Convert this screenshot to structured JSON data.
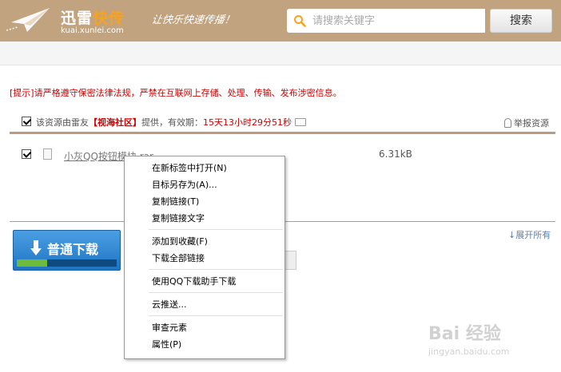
{
  "header": {
    "brand_main": "迅雷",
    "brand_accent": "快传",
    "brand_domain": "kuai.xunlei.com",
    "slogan": "让快乐快速传播！",
    "search_placeholder": "请搜索关键字",
    "search_button": "搜索"
  },
  "notice": "[提示]请严格遵守保密法律法规，严禁在互联网上存储、处理、传输、发布涉密信息。",
  "resource_info": {
    "prefix": "该资源由雷友",
    "uploader": "【视海社区】",
    "middle": "提供，有效期：",
    "expires": "15天13小时29分51秒",
    "report": "举报资源"
  },
  "files": [
    {
      "name": "小灰QQ按钮模块.rar",
      "size": "6.31kB"
    }
  ],
  "expand_all": "展开所有",
  "download_button": {
    "label": "普通下载",
    "progress": 0.3
  },
  "context_menu": {
    "groups": [
      [
        "在新标签中打开(N)",
        "目标另存为(A)...",
        "复制链接(T)",
        "复制链接文字"
      ],
      [
        "添加到收藏(F)",
        "下载全部链接"
      ],
      [
        "使用QQ下载助手下载"
      ],
      [
        "云推送..."
      ],
      [
        "审查元素",
        "属性(P)"
      ]
    ]
  },
  "watermark": {
    "brand": "Bai 经验",
    "url": "jingyan.baidu.com"
  },
  "colors": {
    "header_bg": "#c2a37f",
    "accent": "#f6a321",
    "warning": "#cc0000",
    "divider": "#b89c82",
    "download_blue": "#1f74c3",
    "progress_green": "#6dbb3a"
  }
}
